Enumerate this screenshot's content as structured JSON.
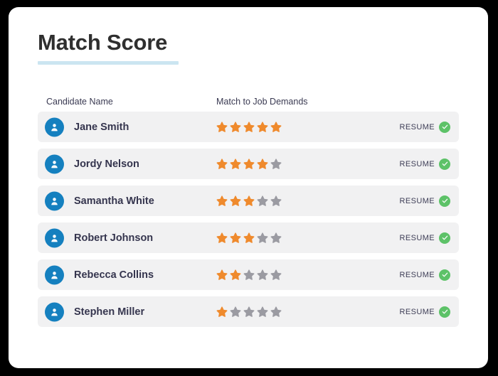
{
  "card": {
    "title": "Match Score",
    "columns": {
      "candidate": "Candidate Name",
      "match": "Match to Job Demands"
    },
    "resume_label": "RESUME",
    "star_total": 5,
    "colors": {
      "star_filled": "#ef8a2d",
      "star_empty": "#9b9ba2",
      "avatar": "#1580bf",
      "check": "#5dc268",
      "underline": "#cbe5f1",
      "row_background": "#f1f1f2"
    },
    "rows": [
      {
        "name": "Jane Smith",
        "stars": 5,
        "resume": "RESUME"
      },
      {
        "name": "Jordy Nelson",
        "stars": 4,
        "resume": "RESUME"
      },
      {
        "name": "Samantha White",
        "stars": 3,
        "resume": "RESUME"
      },
      {
        "name": "Robert Johnson",
        "stars": 3,
        "resume": "RESUME"
      },
      {
        "name": "Rebecca Collins",
        "stars": 2,
        "resume": "RESUME"
      },
      {
        "name": "Stephen Miller",
        "stars": 1,
        "resume": "RESUME"
      }
    ]
  }
}
